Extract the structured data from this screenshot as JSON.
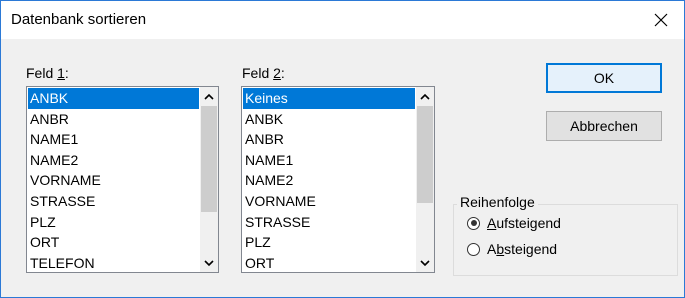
{
  "dialog": {
    "title": "Datenbank sortieren"
  },
  "field1": {
    "label_pre": "Feld ",
    "label_key": "1",
    "label_post": ":",
    "items": [
      "ANBK",
      "ANBR",
      "NAME1",
      "NAME2",
      "VORNAME",
      "STRASSE",
      "PLZ",
      "ORT",
      "TELEFON"
    ],
    "selected_index": 0
  },
  "field2": {
    "label_pre": "Feld ",
    "label_key": "2",
    "label_post": ":",
    "items": [
      "Keines",
      "ANBK",
      "ANBR",
      "NAME1",
      "NAME2",
      "VORNAME",
      "STRASSE",
      "PLZ",
      "ORT"
    ],
    "selected_index": 0
  },
  "buttons": {
    "ok": "OK",
    "cancel": "Abbrechen"
  },
  "order": {
    "legend": "Reihenfolge",
    "asc_key": "A",
    "asc_rest": "ufsteigend",
    "desc_pre": "A",
    "desc_key": "b",
    "desc_rest": "steigend",
    "selected": "asc"
  },
  "colors": {
    "selection": "#0078d7",
    "window_border": "#2b79d6",
    "dialog_bg": "#f0f0f0"
  },
  "icons": {
    "close": "close-icon",
    "scroll_up": "chevron-up-icon",
    "scroll_down": "chevron-down-icon"
  }
}
